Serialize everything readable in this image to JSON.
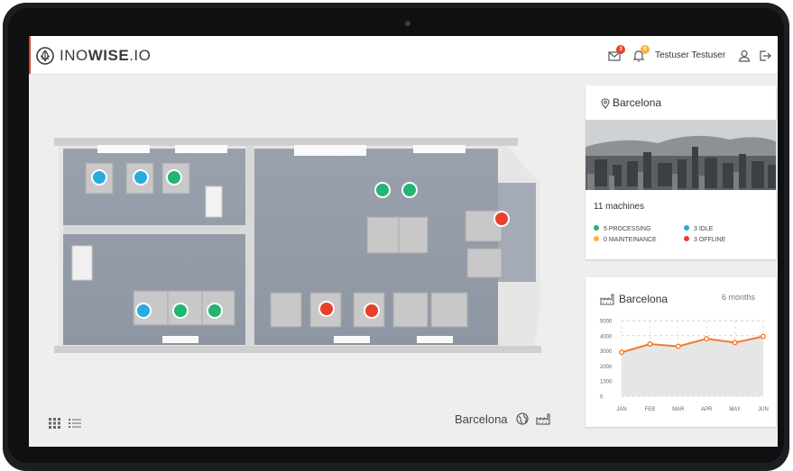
{
  "app": {
    "brand_light": "INO",
    "brand_bold": "WISE",
    "brand_suffix": ".IO"
  },
  "topbar": {
    "mail_badge": "3",
    "bell_badge": "0",
    "username": "Testuser Testuser",
    "icons": [
      "mail-icon",
      "bell-icon",
      "user-icon",
      "logout-icon"
    ]
  },
  "colors": {
    "accent": "#d9432f",
    "processing": "#22b573",
    "idle": "#29abe2",
    "maintenance": "#fbb03b",
    "offline": "#e8402a",
    "chart_line": "#f27b2a"
  },
  "map": {
    "location": "Barcelona",
    "icons": [
      "globe-icon",
      "factory-icon"
    ],
    "view_icons": [
      "grid-view-icon",
      "list-view-icon"
    ]
  },
  "location_card": {
    "title": "Barcelona",
    "machines": "11 machines",
    "stats": [
      {
        "label": "5 PROCESSING",
        "status": "processing"
      },
      {
        "label": "3 IDLE",
        "status": "idle"
      },
      {
        "label": "0 MAINTEINANCE",
        "status": "maintenance"
      },
      {
        "label": "3 OFFLINE",
        "status": "offline"
      }
    ]
  },
  "chart_card": {
    "title": "Barcelona",
    "range": "6 months"
  },
  "chart_data": {
    "type": "line",
    "categories": [
      "JAN",
      "FEB",
      "MAR",
      "APR",
      "MAY",
      "JUN"
    ],
    "values": [
      2900,
      3450,
      3300,
      3800,
      3550,
      3950
    ],
    "yticks": [
      "5000",
      "4000",
      "3000",
      "2000",
      "1000",
      "0"
    ],
    "ylim": [
      0,
      5000
    ],
    "grid": true
  }
}
